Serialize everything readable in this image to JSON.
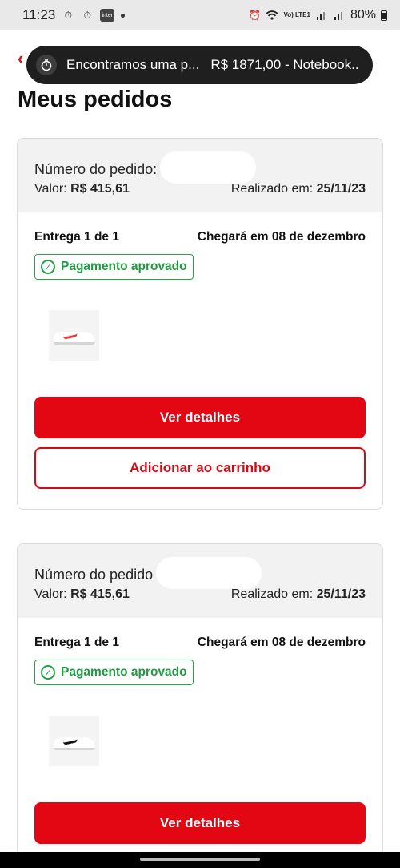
{
  "status_bar": {
    "time": "11:23",
    "volte": "Vo) LTE1",
    "battery": "80%"
  },
  "notification": {
    "text": "Encontramos uma p...",
    "detail": "R$ 1871,00 - Notebook..."
  },
  "page": {
    "title": "Meus pedidos"
  },
  "orders": [
    {
      "number_label": "Número do pedido:",
      "value_label": "Valor:",
      "value": "R$ 415,61",
      "date_label": "Realizado em:",
      "date": "25/11/23",
      "delivery": "Entrega 1 de 1",
      "arrival": "Chegará em 08 de dezembro",
      "payment_status": "Pagamento aprovado",
      "details_button": "Ver detalhes",
      "cart_button": "Adicionar ao carrinho"
    },
    {
      "number_label": "Número do pedido",
      "value_label": "Valor:",
      "value": "R$ 415,61",
      "date_label": "Realizado em:",
      "date": "25/11/23",
      "delivery": "Entrega 1 de 1",
      "arrival": "Chegará em 08 de dezembro",
      "payment_status": "Pagamento aprovado",
      "details_button": "Ver detalhes"
    }
  ],
  "colors": {
    "brand_red": "#e30613",
    "success_green": "#22a547"
  }
}
